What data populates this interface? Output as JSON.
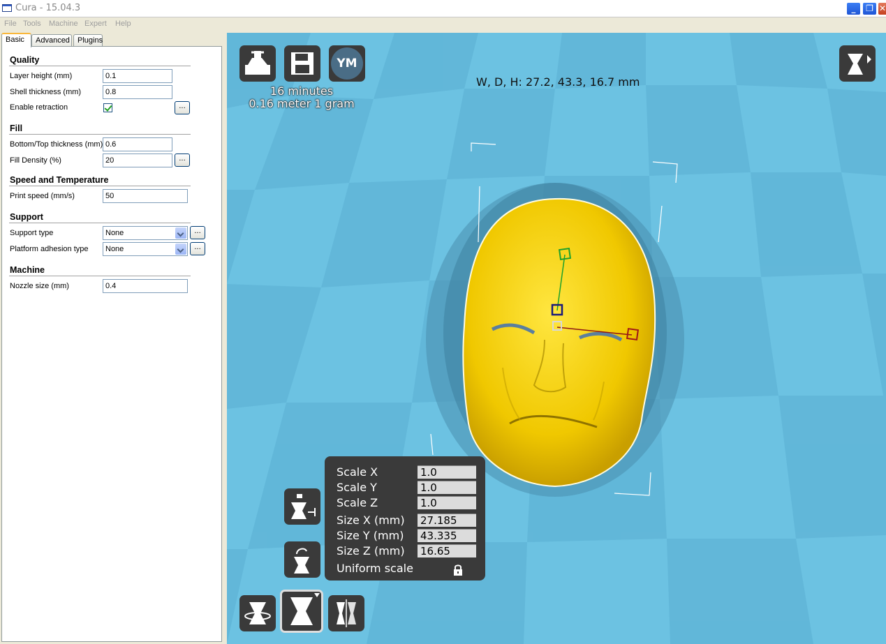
{
  "window": {
    "title": "Cura - 15.04.3"
  },
  "titlebar_buttons": [
    "_",
    "❐",
    "✕"
  ],
  "menu": [
    "File",
    "Tools",
    "Machine",
    "Expert",
    "Help"
  ],
  "tabs": [
    "Basic",
    "Advanced",
    "Plugins"
  ],
  "sections": {
    "quality": {
      "title": "Quality",
      "layer_height": {
        "label": "Layer height (mm)",
        "value": "0.1"
      },
      "shell_thickness": {
        "label": "Shell thickness (mm)",
        "value": "0.8"
      },
      "retraction": {
        "label": "Enable retraction",
        "checked": true
      }
    },
    "fill": {
      "title": "Fill",
      "bottom_top": {
        "label": "Bottom/Top thickness (mm)",
        "value": "0.6"
      },
      "fill_density": {
        "label": "Fill Density (%)",
        "value": "20"
      }
    },
    "speed": {
      "title": "Speed and Temperature",
      "print_speed": {
        "label": "Print speed (mm/s)",
        "value": "50"
      }
    },
    "support": {
      "title": "Support",
      "support_type": {
        "label": "Support type",
        "value": "None"
      },
      "adhesion": {
        "label": "Platform adhesion type",
        "value": "None"
      }
    },
    "machine": {
      "title": "Machine",
      "nozzle": {
        "label": "Nozzle size (mm)",
        "value": "0.4"
      }
    }
  },
  "dots_label": "...",
  "viewport": {
    "print_time": "16 minutes",
    "print_material": "0.16 meter 1 gram",
    "dimensions": "W, D, H: 27.2, 43.3, 16.7 mm",
    "ym_label": "YM",
    "bed_color": "#6cc2e2",
    "model_color": "#f0c800",
    "icons": {
      "load": "load-model-icon",
      "save": "save-gcode-icon",
      "ym": "youmagine-icon",
      "view": "view-mode-icon",
      "lay_flat": "lay-flat-icon",
      "mirror": "mirror-icon",
      "rotate": "rotate-icon",
      "scale": "scale-icon",
      "mirror_bottom": "mirror-bottom-icon"
    }
  },
  "scale_panel": {
    "scale_x": {
      "label": "Scale X",
      "value": "1.0"
    },
    "scale_y": {
      "label": "Scale Y",
      "value": "1.0"
    },
    "scale_z": {
      "label": "Scale Z",
      "value": "1.0"
    },
    "size_x": {
      "label": "Size X (mm)",
      "value": "27.185"
    },
    "size_y": {
      "label": "Size Y (mm)",
      "value": "43.335"
    },
    "size_z": {
      "label": "Size Z (mm)",
      "value": "16.65"
    },
    "uniform": {
      "label": "Uniform scale",
      "locked": true
    }
  }
}
